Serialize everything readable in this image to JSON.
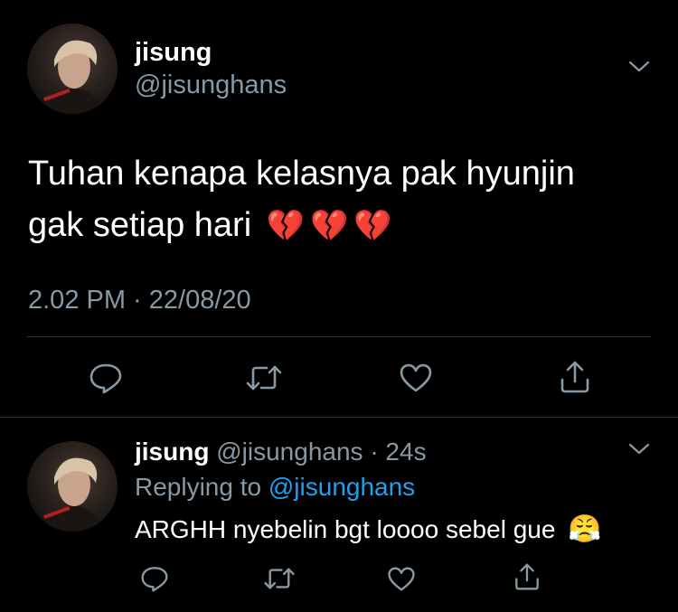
{
  "tweet": {
    "display_name": "jisung",
    "handle": "@jisunghans",
    "text_line1": "Tuhan kenapa kelasnya pak hyunjin",
    "text_line2": "gak setiap hari",
    "emoji": "💔💔💔",
    "timestamp": "2.02 PM · 22/08/20",
    "icons": [
      "reply-icon",
      "retweet-icon",
      "like-icon",
      "share-icon"
    ]
  },
  "reply": {
    "display_name": "jisung",
    "handle": "@jisunghans",
    "time": "· 24s",
    "replying_prefix": "Replying to",
    "replying_handle": "@jisunghans",
    "text": "ARGHH nyebelin bgt loooo sebel gue",
    "emoji": "😤"
  },
  "colors": {
    "background": "#000000",
    "muted": "#8899a6",
    "link": "#1da1f2",
    "divider": "#2f3336"
  }
}
